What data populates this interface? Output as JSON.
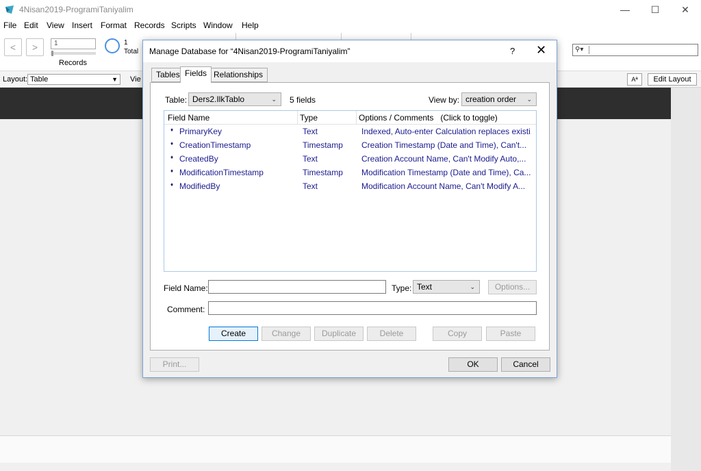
{
  "window": {
    "title": "4Nisan2019-ProgramiTaniyalim",
    "minimize": "—",
    "maximize": "☐",
    "close": "✕"
  },
  "menu": [
    "File",
    "Edit",
    "View",
    "Insert",
    "Format",
    "Records",
    "Scripts",
    "Window",
    "Help"
  ],
  "toolbar": {
    "prev": "<",
    "next": ">",
    "record_value": "1",
    "records_label": "Records",
    "total_count": "1",
    "total_label": "Total"
  },
  "layoutbar": {
    "layout_label": "Layout:",
    "layout_value": "Table",
    "view_label": "Vie",
    "aa_label": "Aª",
    "edit_layout": "Edit Layout"
  },
  "dialog": {
    "title": "Manage Database for “4Nisan2019-ProgramiTaniyalim”",
    "help": "?",
    "close": "✕",
    "tabs": [
      {
        "label": "Tables",
        "active": false
      },
      {
        "label": "Fields",
        "active": true
      },
      {
        "label": "Relationships",
        "active": false
      }
    ],
    "table_label": "Table:",
    "table_value": "Ders2.IlkTablo",
    "field_count": "5 fields",
    "viewby_label": "View by:",
    "viewby_value": "creation order",
    "columns": [
      "Field Name",
      "Type",
      "Options / Comments   (Click to toggle)"
    ],
    "fields": [
      {
        "name": "PrimaryKey",
        "type": "Text",
        "options": "Indexed, Auto-enter Calculation replaces existi..."
      },
      {
        "name": "CreationTimestamp",
        "type": "Timestamp",
        "options": "Creation Timestamp (Date and Time), Can't..."
      },
      {
        "name": "CreatedBy",
        "type": "Text",
        "options": "Creation Account Name, Can't Modify Auto,..."
      },
      {
        "name": "ModificationTimestamp",
        "type": "Timestamp",
        "options": "Modification Timestamp (Date and Time), Ca..."
      },
      {
        "name": "ModifiedBy",
        "type": "Text",
        "options": "Modification Account Name, Can't Modify A..."
      }
    ],
    "field_name_label": "Field Name:",
    "field_name_value": "",
    "type_label": "Type:",
    "type_value": "Text",
    "options_button": "Options...",
    "comment_label": "Comment:",
    "comment_value": "",
    "buttons": {
      "create": "Create",
      "change": "Change",
      "duplicate": "Duplicate",
      "delete": "Delete",
      "copy": "Copy",
      "paste": "Paste",
      "print": "Print...",
      "ok": "OK",
      "cancel": "Cancel"
    }
  }
}
